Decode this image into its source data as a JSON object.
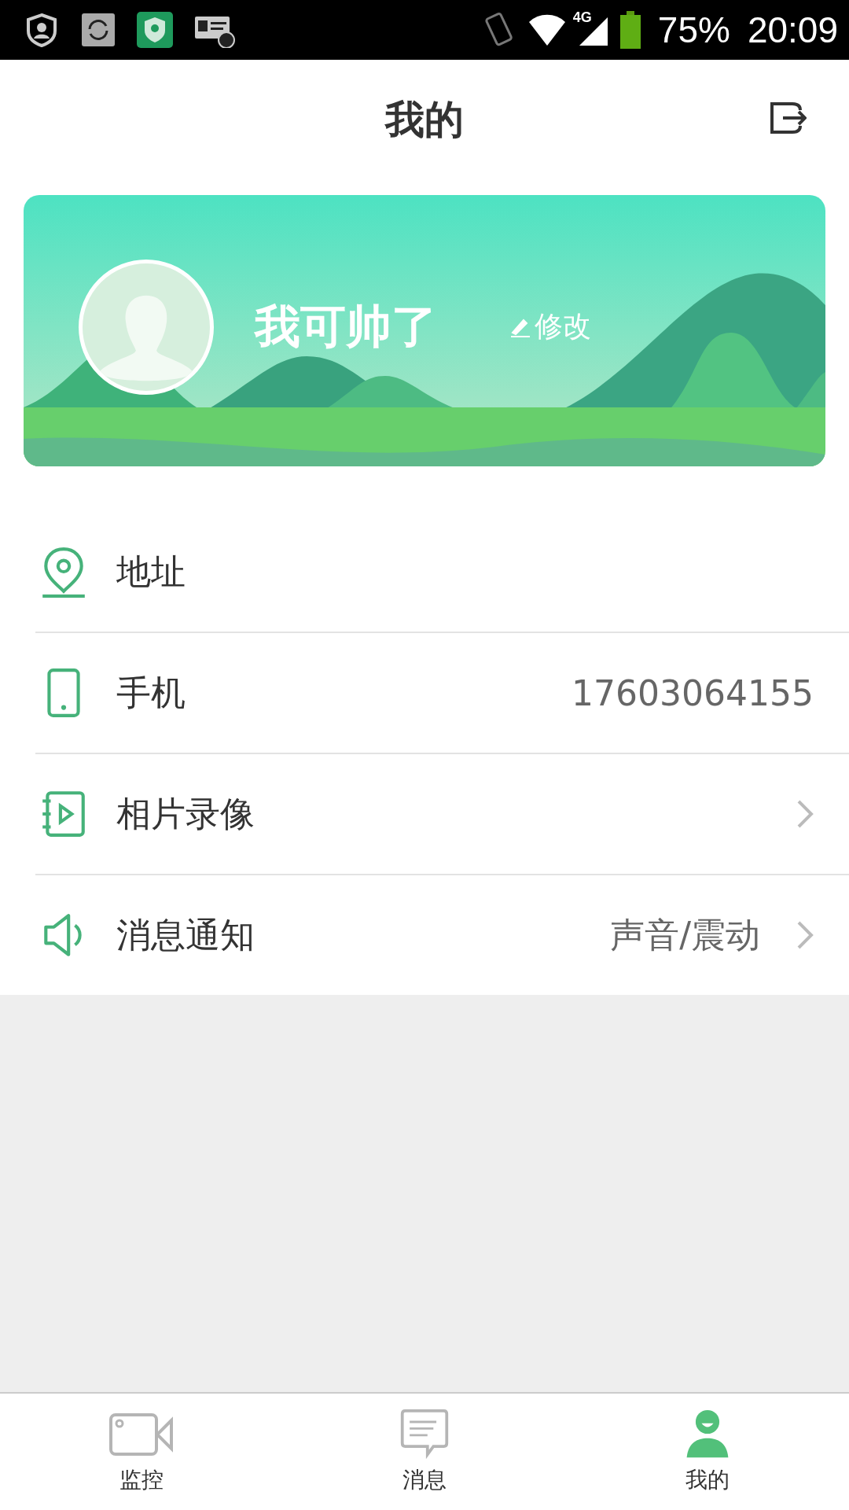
{
  "status_bar": {
    "network": "4G",
    "battery": "75%",
    "time": "20:09"
  },
  "header": {
    "title": "我的"
  },
  "profile": {
    "name": "我可帅了",
    "edit": "修改"
  },
  "menu": [
    {
      "label": "地址",
      "chevron": false
    },
    {
      "label": "手机",
      "value": "17603064155",
      "chevron": false
    },
    {
      "label": "相片录像",
      "chevron": true
    },
    {
      "label": "消息通知",
      "value": "声音/震动",
      "chevron": true
    }
  ],
  "tabs": [
    {
      "label": "监控",
      "selected": false
    },
    {
      "label": "消息",
      "selected": false
    },
    {
      "label": "我的",
      "selected": true
    }
  ]
}
